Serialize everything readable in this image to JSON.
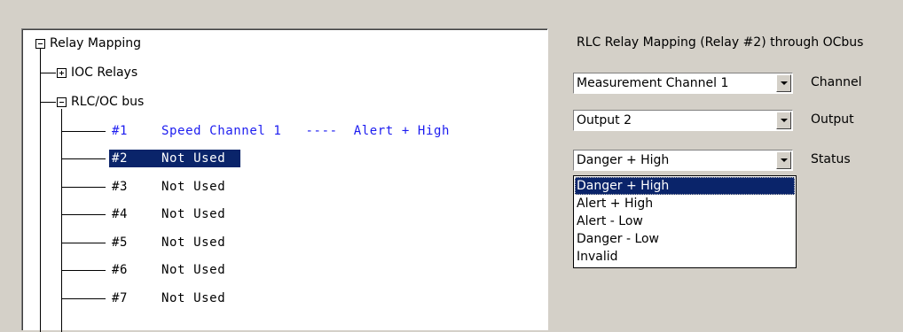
{
  "tree": {
    "root": "Relay Mapping",
    "ioc": "IOC Relays",
    "rlc": "RLC/OC bus",
    "relays": [
      {
        "num": "#1",
        "text": "Speed Channel 1   ----  Alert + High"
      },
      {
        "num": "#2",
        "text": "Not Used"
      },
      {
        "num": "#3",
        "text": "Not Used"
      },
      {
        "num": "#4",
        "text": "Not Used"
      },
      {
        "num": "#5",
        "text": "Not Used"
      },
      {
        "num": "#6",
        "text": "Not Used"
      },
      {
        "num": "#7",
        "text": "Not Used"
      }
    ]
  },
  "panel": {
    "title": "RLC Relay Mapping (Relay #2) through OCbus",
    "channel": {
      "value": "Measurement Channel 1",
      "label": "Channel"
    },
    "output": {
      "value": "Output 2",
      "label": "Output"
    },
    "status": {
      "value": "Danger + High",
      "label": "Status"
    },
    "status_options": [
      "Danger + High",
      "Alert + High",
      "Alert - Low",
      "Danger - Low",
      "Invalid"
    ]
  },
  "colors": {
    "selection": "#0a246a",
    "assigned_text": "#1c1cf0",
    "background": "#d4d0c8"
  }
}
